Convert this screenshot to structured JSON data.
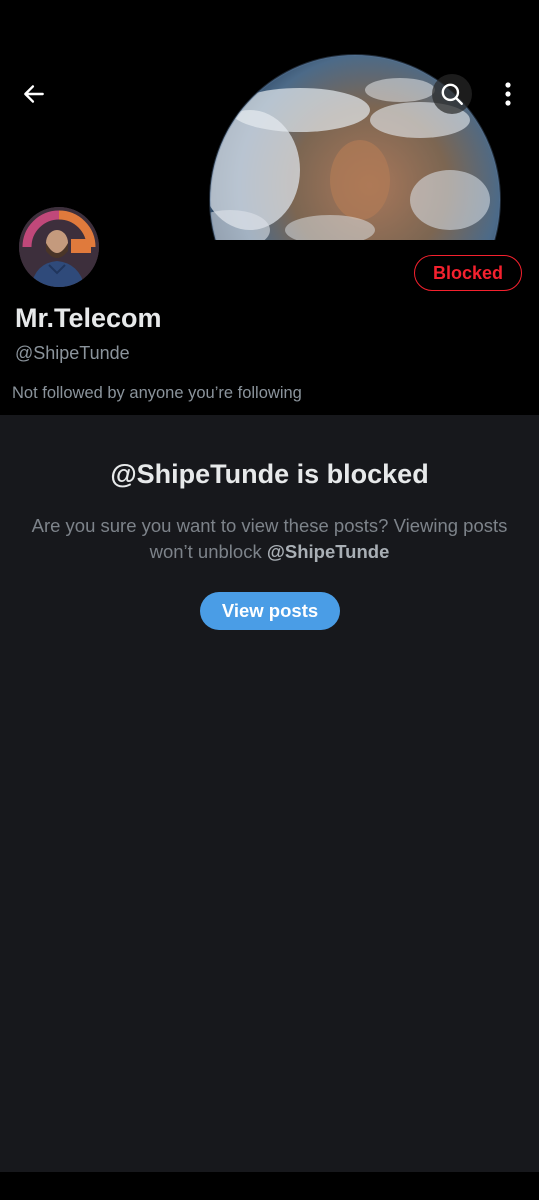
{
  "header": {
    "back_icon": "arrow-left-icon",
    "search_icon": "search-icon",
    "more_icon": "more-vertical-icon"
  },
  "profile": {
    "display_name": "Mr.Telecom",
    "handle": "@ShipeTunde",
    "blocked_label": "Blocked",
    "follow_note": "Not followed by anyone you’re following"
  },
  "blocked_panel": {
    "title": "@ShipeTunde is blocked",
    "message_part": "Are you sure you want to view these posts? Viewing posts won’t unblock ",
    "mention": "@ShipeTunde",
    "view_posts_label": "View posts"
  },
  "colors": {
    "background": "#000000",
    "panel": "#17181c",
    "blocked_red": "#f4212e",
    "accent_blue": "#4a9de6",
    "muted_text": "#8b949c"
  }
}
